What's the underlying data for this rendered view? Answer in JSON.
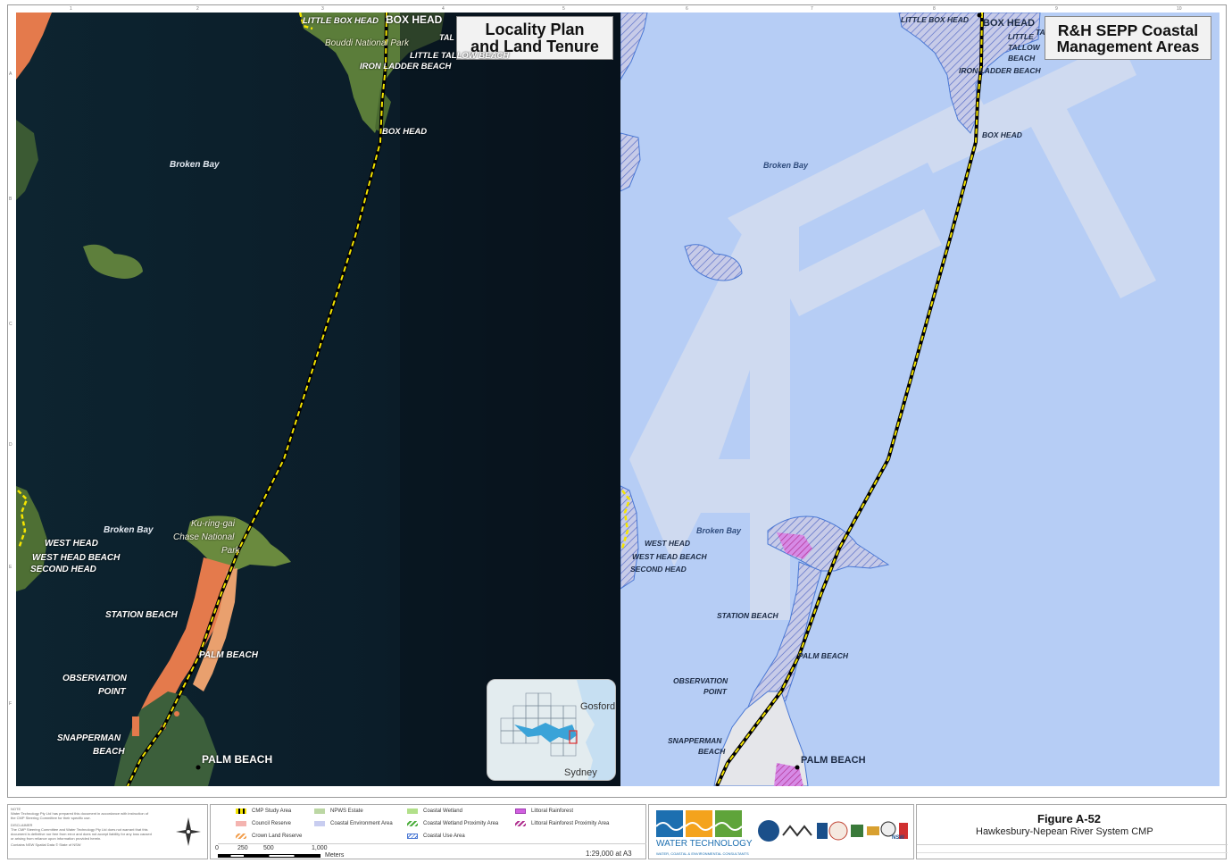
{
  "left_panel": {
    "title_line1": "Locality Plan",
    "title_line2": "and Land Tenure",
    "labels": {
      "little_box_head": "LITTLE BOX HEAD",
      "box_head_top": "BOX HEAD",
      "bouddi": "Bouddi National Park",
      "tal": "TAL",
      "little_tallow": "LITTLE TALLOW BEACH",
      "iron_ladder": "IRON LADDER BEACH",
      "box_head": "BOX HEAD",
      "broken_bay_1": "Broken Bay",
      "broken_bay_2": "Broken Bay",
      "kuringgai_1": "Ku-ring-gai",
      "kuringgai_2": "Chase National",
      "kuringgai_3": "Park",
      "west_head": "WEST HEAD",
      "west_head_beach": "WEST HEAD BEACH",
      "second_head": "SECOND HEAD",
      "station_beach": "STATION BEACH",
      "palm_beach_mid": "PALM BEACH",
      "observation_1": "OBSERVATION",
      "observation_2": "POINT",
      "snapperman_1": "SNAPPERMAN",
      "snapperman_2": "BEACH",
      "palm_beach": "PALM BEACH"
    },
    "inset": {
      "gosford": "Gosford",
      "sydney": "Sydney"
    }
  },
  "right_panel": {
    "title_line1": "R&H SEPP Coastal",
    "title_line2": "Management Areas",
    "labels": {
      "little_box_head": "LITTLE BOX HEAD",
      "box_head_top": "BOX HEAD",
      "ta": "TA",
      "little": "LITTLE",
      "tallow": "TALLOW",
      "beach": "BEACH",
      "iron_ladder": "IRON LADDER BEACH",
      "box_head": "BOX HEAD",
      "broken_bay_1": "Broken Bay",
      "broken_bay_2": "Broken Bay",
      "west_head": "WEST HEAD",
      "west_head_beach": "WEST HEAD BEACH",
      "second_head": "SECOND HEAD",
      "station_beach": "STATION BEACH",
      "palm_beach_mid": "PALM BEACH",
      "observation_1": "OBSERVATION",
      "observation_2": "POINT",
      "snapperman_1": "SNAPPERMAN",
      "snapperman_2": "BEACH",
      "palm_beach": "PALM BEACH"
    }
  },
  "legend": {
    "items": [
      {
        "label": "CMP Study Area",
        "color": "#f5e500"
      },
      {
        "label": "Council Reserve",
        "color": "#f4b4b0"
      },
      {
        "label": "Crown Land Reserve",
        "color": "#f2a050"
      },
      {
        "label": "NPWS Estate",
        "color": "#bcd7a4"
      },
      {
        "label": "Coastal Environment Area",
        "color": "#c8cdf0"
      },
      {
        "label": "Coastal Wetland",
        "color": "#b2e08a"
      },
      {
        "label": "Coastal Wetland Proximity Area",
        "color": "#4cae3c"
      },
      {
        "label": "Coastal Use Area",
        "color": "#4a78d4"
      },
      {
        "label": "Littoral Rainforest",
        "color": "#d15fe0"
      },
      {
        "label": "Littoral Rainforest Proximity Area",
        "color": "#b0308f"
      }
    ],
    "scale": {
      "t0": "0",
      "t1": "250",
      "t2": "500",
      "t3": "1,000",
      "unit": "Meters",
      "ratio": "1:29,000 at A3"
    }
  },
  "notes": {
    "heading": "NOTE",
    "text": "Water Technology Pty Ltd has prepared this document in accordance with instruction of the CMP Steering Committee for their specific use.",
    "disclaimer_heading": "DISCLAIMER",
    "disclaimer": "The CMP Steering Committee and Water Technology Pty Ltd does not warrant that this document is definitive nor free from error and does not accept liability for any loss caused or arising from reliance upon information provided herein.",
    "copyright": "Contains NSW Spatial Data © State of NSW"
  },
  "branding": {
    "org_line1": "WATER TECHNOLOGY",
    "org_line2": "WATER, COASTAL & ENVIRONMENTAL CONSULTANTS",
    "nsw": "NSW"
  },
  "figure": {
    "number": "Figure A-52",
    "title": "Hawkesbury-Nepean River System CMP"
  },
  "grid": {
    "cols": [
      "1",
      "2",
      "3",
      "4",
      "5",
      "6",
      "7",
      "8",
      "9",
      "10"
    ],
    "rows": [
      "A",
      "B",
      "C",
      "D",
      "E",
      "F"
    ]
  },
  "colors": {
    "study_area": "#f5e500",
    "crown_land": "#f2a050",
    "npws": "#5e8a3a",
    "coastal_env": "#b6cdf5",
    "coastal_use": "#4a78d4",
    "rainforest": "#d15fe0"
  }
}
